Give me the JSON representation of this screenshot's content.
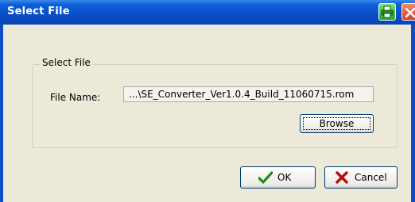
{
  "window": {
    "title": "Select File"
  },
  "group": {
    "label": "Select File"
  },
  "file": {
    "label": "File Name:",
    "value": "...\\SE_Converter_Ver1.0.4_Build_11060715.rom"
  },
  "buttons": {
    "browse": "Browse",
    "ok": "OK",
    "cancel": "Cancel"
  },
  "icons": {
    "titlebar_extra": "printer-icon",
    "close": "close-icon",
    "ok": "checkmark-icon",
    "cancel": "x-icon"
  },
  "colors": {
    "titlebar": "#0a4fc8",
    "face": "#ece9d8",
    "close": "#d4422a",
    "ok_check": "#1e8a1e",
    "cancel_x": "#b01010"
  }
}
